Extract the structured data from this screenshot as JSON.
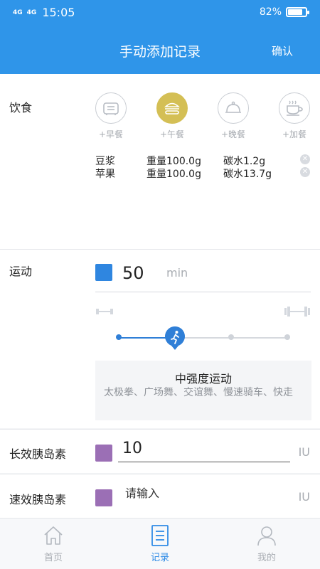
{
  "status_bar": {
    "signal_1": "4G",
    "signal_2": "4G",
    "time": "15:05",
    "battery_text": "82%",
    "battery_level": 0.82
  },
  "header": {
    "title": "手动添加记录",
    "confirm_label": "确认"
  },
  "diet": {
    "label": "饮食",
    "meals": [
      {
        "label": "+早餐",
        "icon": "toaster-icon",
        "selected": false
      },
      {
        "label": "+午餐",
        "icon": "burger-icon",
        "selected": true
      },
      {
        "label": "+晚餐",
        "icon": "dish-cover-icon",
        "selected": false
      },
      {
        "label": "+加餐",
        "icon": "coffee-cup-icon",
        "selected": false
      }
    ],
    "foods": [
      {
        "name": "豆浆",
        "weight": "重量100.0g",
        "carbs": "碳水1.2g"
      },
      {
        "name": "苹果",
        "weight": "重量100.0g",
        "carbs": "碳水13.7g"
      }
    ]
  },
  "exercise": {
    "label": "运动",
    "duration_value": "50",
    "duration_unit": "min",
    "intensity_level": 2,
    "intensity_levels_total": 4,
    "intensity_title": "中强度运动",
    "intensity_description": "太极拳、广场舞、交谊舞、慢速骑车、快走",
    "low_icon": "light-dumbbell-icon",
    "high_icon": "heavy-dumbbell-icon",
    "square_color": "#2f86e0"
  },
  "long_insulin": {
    "label": "长效胰岛素",
    "value": "10",
    "unit": "IU",
    "square_color": "#9b6fb5"
  },
  "short_insulin": {
    "label": "速效胰岛素",
    "placeholder": "请输入",
    "unit": "IU",
    "square_color": "#9b6fb5"
  },
  "tabs": [
    {
      "label": "首页",
      "icon": "home-icon",
      "active": false
    },
    {
      "label": "记录",
      "icon": "record-icon",
      "active": true
    },
    {
      "label": "我的",
      "icon": "profile-icon",
      "active": false
    }
  ],
  "colors": {
    "primary": "#2f95e9",
    "accent_gold": "#d4bf55",
    "tab_active": "#2f8be6"
  }
}
